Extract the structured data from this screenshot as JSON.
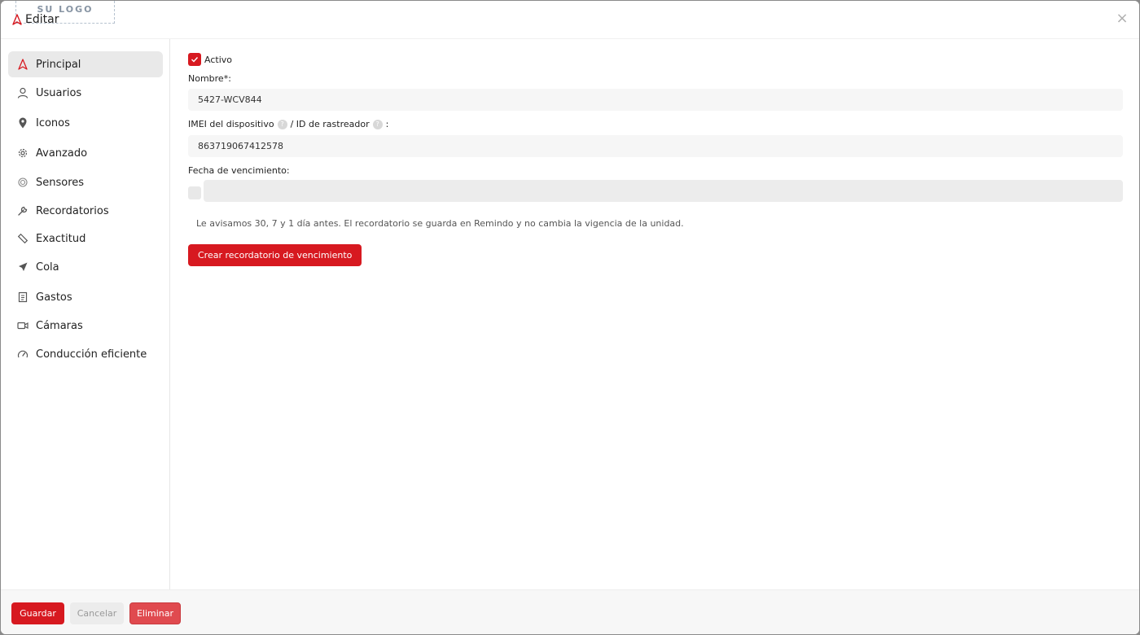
{
  "header": {
    "logo_text": "SU LOGO",
    "title": "Editar",
    "close_label": "×"
  },
  "sidebar": {
    "items": [
      {
        "label": "Principal",
        "icon": "navigation-arrow-icon",
        "active": true
      },
      {
        "label": "Usuarios",
        "icon": "user-icon"
      },
      {
        "label": "Iconos",
        "icon": "map-pin-icon"
      },
      {
        "label": "Avanzado",
        "icon": "gear-icon"
      },
      {
        "label": "Sensores",
        "icon": "sensor-icon"
      },
      {
        "label": "Recordatorios",
        "icon": "wrench-icon"
      },
      {
        "label": "Exactitud",
        "icon": "ruler-icon"
      },
      {
        "label": "Cola",
        "icon": "send-icon"
      },
      {
        "label": "Gastos",
        "icon": "receipt-icon"
      },
      {
        "label": "Cámaras",
        "icon": "camera-icon"
      },
      {
        "label": "Conducción eficiente",
        "icon": "speedometer-icon"
      }
    ]
  },
  "form": {
    "active_label": "Activo",
    "active_checked": true,
    "name_label": "Nombre*:",
    "name_value": "5427-WCV844",
    "imei_label_part1": "IMEI del dispositivo",
    "imei_label_sep": "/ ID de rastreador",
    "imei_label_end": ":",
    "imei_value": "863719067412578",
    "expiry_label": "Fecha de vencimiento:",
    "hint": "Le avisamos 30, 7 y 1 día antes. El recordatorio se guarda en Remindo y no cambia la vigencia de la unidad.",
    "create_reminder_label": "Crear recordatorio de vencimiento"
  },
  "footer": {
    "save_label": "Guardar",
    "cancel_label": "Cancelar",
    "delete_label": "Eliminar"
  },
  "colors": {
    "accent": "#d71920",
    "delete": "#e04a4f"
  }
}
